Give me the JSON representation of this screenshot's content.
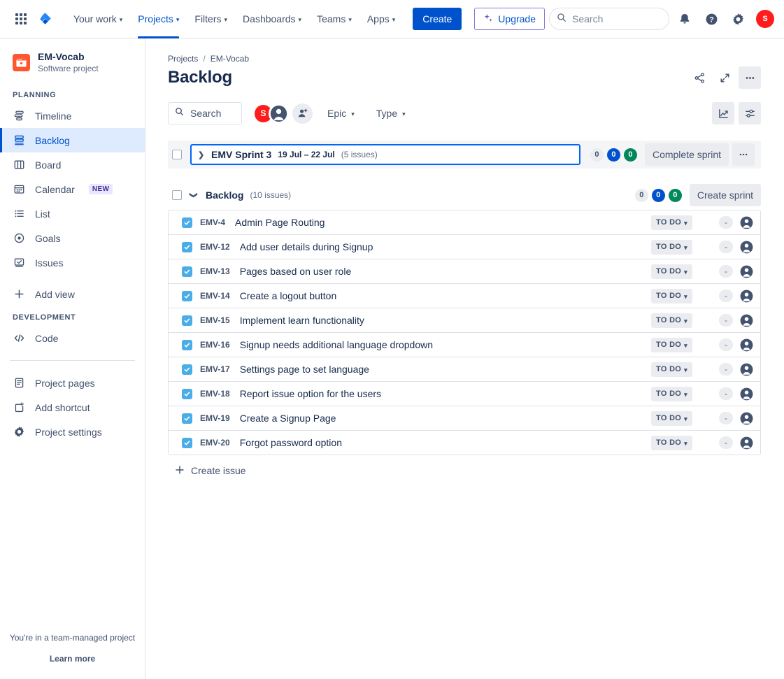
{
  "topnav": {
    "app_switcher": "app-switcher",
    "logo": "jira-logo",
    "items": [
      {
        "label": "Your work",
        "has_caret": true,
        "active": false
      },
      {
        "label": "Projects",
        "has_caret": true,
        "active": true
      },
      {
        "label": "Filters",
        "has_caret": true,
        "active": false
      },
      {
        "label": "Dashboards",
        "has_caret": true,
        "active": false
      },
      {
        "label": "Teams",
        "has_caret": true,
        "active": false
      },
      {
        "label": "Apps",
        "has_caret": true,
        "active": false
      }
    ],
    "create_label": "Create",
    "upgrade_label": "Upgrade",
    "search_placeholder": "Search",
    "search_value": "",
    "notifications_icon": "notification-bell-icon",
    "help_icon": "help-icon",
    "settings_icon": "gear-icon",
    "profile_initial": "S"
  },
  "sidebar": {
    "project_name": "EM-Vocab",
    "project_type": "Software project",
    "planning_label": "PLANNING",
    "planning_items": [
      {
        "label": "Timeline",
        "icon": "timeline-icon",
        "selected": false,
        "badge": ""
      },
      {
        "label": "Backlog",
        "icon": "backlog-icon",
        "selected": true,
        "badge": ""
      },
      {
        "label": "Board",
        "icon": "board-icon",
        "selected": false,
        "badge": ""
      },
      {
        "label": "Calendar",
        "icon": "calendar-icon",
        "selected": false,
        "badge": "NEW"
      },
      {
        "label": "List",
        "icon": "list-icon",
        "selected": false,
        "badge": ""
      },
      {
        "label": "Goals",
        "icon": "goals-icon",
        "selected": false,
        "badge": ""
      },
      {
        "label": "Issues",
        "icon": "issues-icon",
        "selected": false,
        "badge": ""
      },
      {
        "label": "Add view",
        "icon": "plus-icon",
        "selected": false,
        "badge": ""
      }
    ],
    "development_label": "DEVELOPMENT",
    "development_items": [
      {
        "label": "Code",
        "icon": "code-icon",
        "selected": false,
        "badge": ""
      }
    ],
    "bottom_items": [
      {
        "label": "Project pages",
        "icon": "page-icon"
      },
      {
        "label": "Add shortcut",
        "icon": "add-shortcut-icon"
      },
      {
        "label": "Project settings",
        "icon": "gear-icon"
      }
    ],
    "footer_note": "You're in a team-managed project",
    "footer_link": "Learn more"
  },
  "main": {
    "breadcrumb": [
      "Projects",
      "/",
      "EM-Vocab"
    ],
    "page_title": "Backlog",
    "title_actions": [
      {
        "icon": "share-icon",
        "name": "share-button",
        "filled": false
      },
      {
        "icon": "expand-icon",
        "name": "fullscreen-button",
        "filled": false
      },
      {
        "icon": "more-icon",
        "name": "more-actions-button",
        "filled": true
      }
    ],
    "filterbar": {
      "search_placeholder": "Search",
      "search_value": "",
      "avatars": [
        {
          "initial": "S",
          "name": "avatar-user-s",
          "color": "#FF1C1C"
        },
        {
          "initial": "",
          "name": "avatar-unassigned",
          "color": "#FFFFFF"
        }
      ],
      "add_people_label": "add-people",
      "dropdowns": [
        {
          "label": "Epic",
          "name": "epic-filter"
        },
        {
          "label": "Type",
          "name": "type-filter"
        }
      ],
      "right_actions": [
        {
          "icon": "insights-icon",
          "name": "insights-button"
        },
        {
          "icon": "view-settings-icon",
          "name": "view-settings-button"
        }
      ]
    },
    "sprint": {
      "name": "EMV Sprint 3",
      "dates": "19 Jul – 22 Jul",
      "issue_count": "(5 issues)",
      "badges": [
        {
          "value": "0",
          "tone": "grey"
        },
        {
          "value": "0",
          "tone": "blue"
        },
        {
          "value": "0",
          "tone": "green"
        }
      ],
      "action_label": "Complete sprint",
      "more_label": "sprint-more-actions",
      "expanded": false
    },
    "backlog_group": {
      "title": "Backlog",
      "issue_count": "(10 issues)",
      "badges": [
        {
          "value": "0",
          "tone": "grey"
        },
        {
          "value": "0",
          "tone": "blue"
        },
        {
          "value": "0",
          "tone": "green"
        }
      ],
      "action_label": "Create sprint",
      "expanded": true
    },
    "issues": [
      {
        "key": "EMV-4",
        "summary": "Admin Page Routing",
        "status": "TO DO",
        "epic": "-",
        "type": "task"
      },
      {
        "key": "EMV-12",
        "summary": "Add user details during Signup",
        "status": "TO DO",
        "epic": "-",
        "type": "task"
      },
      {
        "key": "EMV-13",
        "summary": "Pages based on user role",
        "status": "TO DO",
        "epic": "-",
        "type": "task"
      },
      {
        "key": "EMV-14",
        "summary": "Create a logout button",
        "status": "TO DO",
        "epic": "-",
        "type": "task"
      },
      {
        "key": "EMV-15",
        "summary": "Implement learn functionality",
        "status": "TO DO",
        "epic": "-",
        "type": "task"
      },
      {
        "key": "EMV-16",
        "summary": "Signup needs additional language dropdown",
        "status": "TO DO",
        "epic": "-",
        "type": "task"
      },
      {
        "key": "EMV-17",
        "summary": "Settings page to set language",
        "status": "TO DO",
        "epic": "-",
        "type": "task"
      },
      {
        "key": "EMV-18",
        "summary": "Report issue option for the users",
        "status": "TO DO",
        "epic": "-",
        "type": "task"
      },
      {
        "key": "EMV-19",
        "summary": "Create a Signup Page",
        "status": "TO DO",
        "epic": "-",
        "type": "task"
      },
      {
        "key": "EMV-20",
        "summary": "Forgot password option",
        "status": "TO DO",
        "epic": "-",
        "type": "task"
      }
    ],
    "create_issue_label": "Create issue"
  },
  "colors": {
    "brand_blue": "#0052CC",
    "selected_bg": "#DEEBFF",
    "border": "#DFE1E6",
    "text": "#172B4D",
    "subtle_text": "#5E6C84",
    "task_icon": "#4BADE8",
    "avatar_red": "#FF1C1C",
    "project_avatar": "#FF5630",
    "badge_green": "#00875A",
    "sprint_outline": "#0065FF"
  }
}
